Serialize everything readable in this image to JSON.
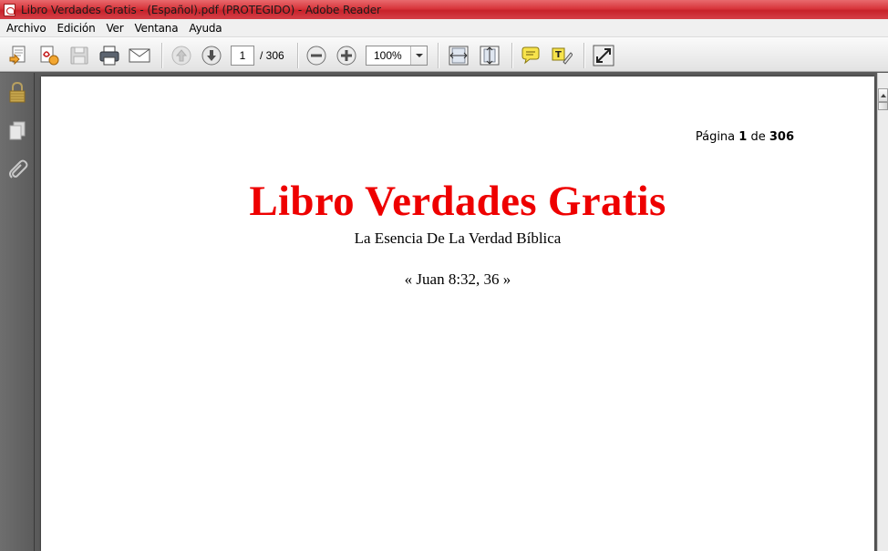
{
  "window": {
    "title": "Libro Verdades Gratis - (Español).pdf (PROTEGIDO) - Adobe Reader"
  },
  "menu": {
    "items": [
      "Archivo",
      "Edición",
      "Ver",
      "Ventana",
      "Ayuda"
    ]
  },
  "toolbar": {
    "icons": [
      "create-pdf-icon",
      "create-pdf-secure-icon",
      "save-icon",
      "print-icon",
      "email-icon",
      "previous-page-icon",
      "next-page-icon",
      "zoom-out-icon",
      "zoom-in-icon",
      "fit-width-icon",
      "fit-page-icon",
      "comment-icon",
      "highlight-icon",
      "full-screen-icon"
    ],
    "page_current": "1",
    "page_total_label": "/  306",
    "zoom_value": "100%"
  },
  "leftnav": {
    "icons": [
      "lock-icon",
      "pages-icon",
      "attachment-icon"
    ]
  },
  "document": {
    "page_label": "Página",
    "page_number": "1",
    "page_of": "de",
    "page_count": "306",
    "title": "Libro Verdades Gratis",
    "subtitle": "La Esencia De La Verdad Bíblica",
    "verse": "« Juan 8:32, 36 »",
    "title_color": "#ee0000"
  }
}
